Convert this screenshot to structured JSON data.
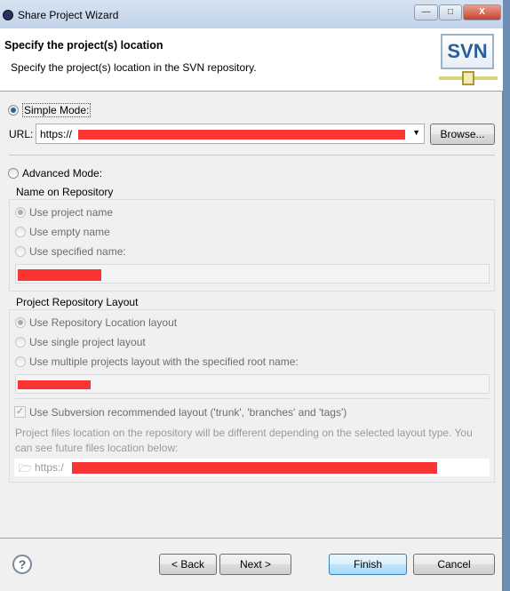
{
  "window": {
    "title": "Share Project Wizard",
    "minimize": "—",
    "maximize": "□",
    "close": "X"
  },
  "header": {
    "title": "Specify the project(s) location",
    "subtitle": "Specify the project(s) location in the SVN repository.",
    "logo_text": "SVN"
  },
  "simple_mode": {
    "label": "Simple Mode:",
    "selected": true,
    "url_label": "URL:",
    "url_value": "https://",
    "browse_label": "Browse..."
  },
  "advanced_mode": {
    "label": "Advanced Mode:",
    "selected": false
  },
  "name_on_repository": {
    "title": "Name on Repository",
    "options": [
      {
        "label": "Use project name",
        "selected": true
      },
      {
        "label": "Use empty name",
        "selected": false
      },
      {
        "label": "Use specified name:",
        "selected": false
      }
    ]
  },
  "repository_layout": {
    "title": "Project Repository Layout",
    "options": [
      {
        "label": "Use Repository Location layout",
        "selected": true
      },
      {
        "label": "Use single project layout",
        "selected": false
      },
      {
        "label": "Use multiple projects layout with the specified root name:",
        "selected": false
      }
    ],
    "recommended_layout_label": "Use Subversion recommended layout ('trunk', 'branches' and 'tags')",
    "recommended_layout_checked": true,
    "description": "Project files location on the repository will be different depending on the selected layout type. You can see future files location below:",
    "future_location": "https:/"
  },
  "footer": {
    "back": "< Back",
    "next": "Next >",
    "finish": "Finish",
    "cancel": "Cancel",
    "help": "?"
  },
  "colors": {
    "redaction": "#fa3434",
    "default_button": "#3c7fb1"
  }
}
